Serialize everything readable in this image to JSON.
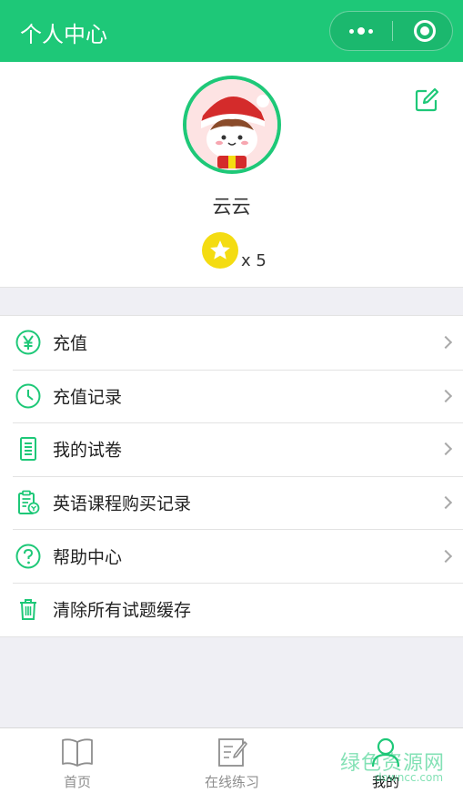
{
  "nav": {
    "title": "个人中心"
  },
  "profile": {
    "nickname": "云云",
    "star_count": "x 5"
  },
  "menu": [
    {
      "label": "充值",
      "icon": "yen-icon"
    },
    {
      "label": "充值记录",
      "icon": "clock-icon"
    },
    {
      "label": "我的试卷",
      "icon": "document-icon"
    },
    {
      "label": "英语课程购买记录",
      "icon": "clipboard-icon"
    },
    {
      "label": "帮助中心",
      "icon": "help-icon"
    },
    {
      "label": "清除所有试题缓存",
      "icon": "trash-icon"
    }
  ],
  "tabbar": {
    "home": "首页",
    "practice": "在线练习",
    "mine": "我的"
  },
  "watermark": {
    "text": "绿色资源网",
    "sub": "downcc.com"
  },
  "colors": {
    "brand": "#1ec878",
    "star": "#f4dc12"
  }
}
